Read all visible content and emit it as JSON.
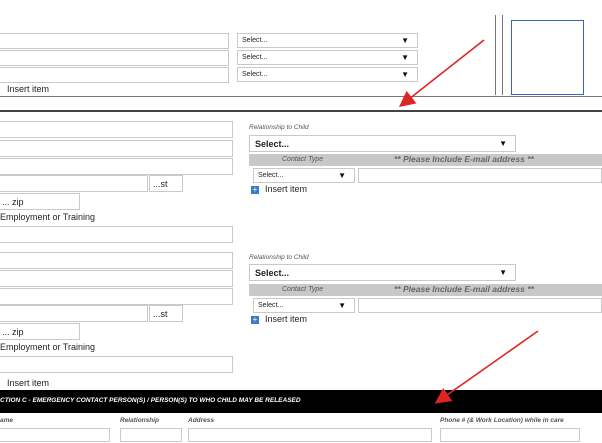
{
  "select_placeholder": "Select...",
  "select_placeholder_bold": "Select...",
  "insert_item": "Insert item",
  "relationship_to_child": "Relationship to Child",
  "contact_type": "Contact Type",
  "email_note": "** Please Include E-mail address **",
  "st_label": "...st",
  "zip_label": "... zip",
  "employment_label": "Employment or Training",
  "section_c": {
    "title": "CTION C - EMERGENCY CONTACT PERSON(S) / PERSON(S) TO WHO CHILD MAY BE RELEASED",
    "columns": [
      "ame",
      "Relationship",
      "Address",
      "Phone # (& Work Location) while in care"
    ]
  },
  "colors": {
    "arrow": "#e02424",
    "select_blue": "#3a7cc8",
    "header_black": "#000000",
    "gray_header": "#c8c8c8"
  }
}
